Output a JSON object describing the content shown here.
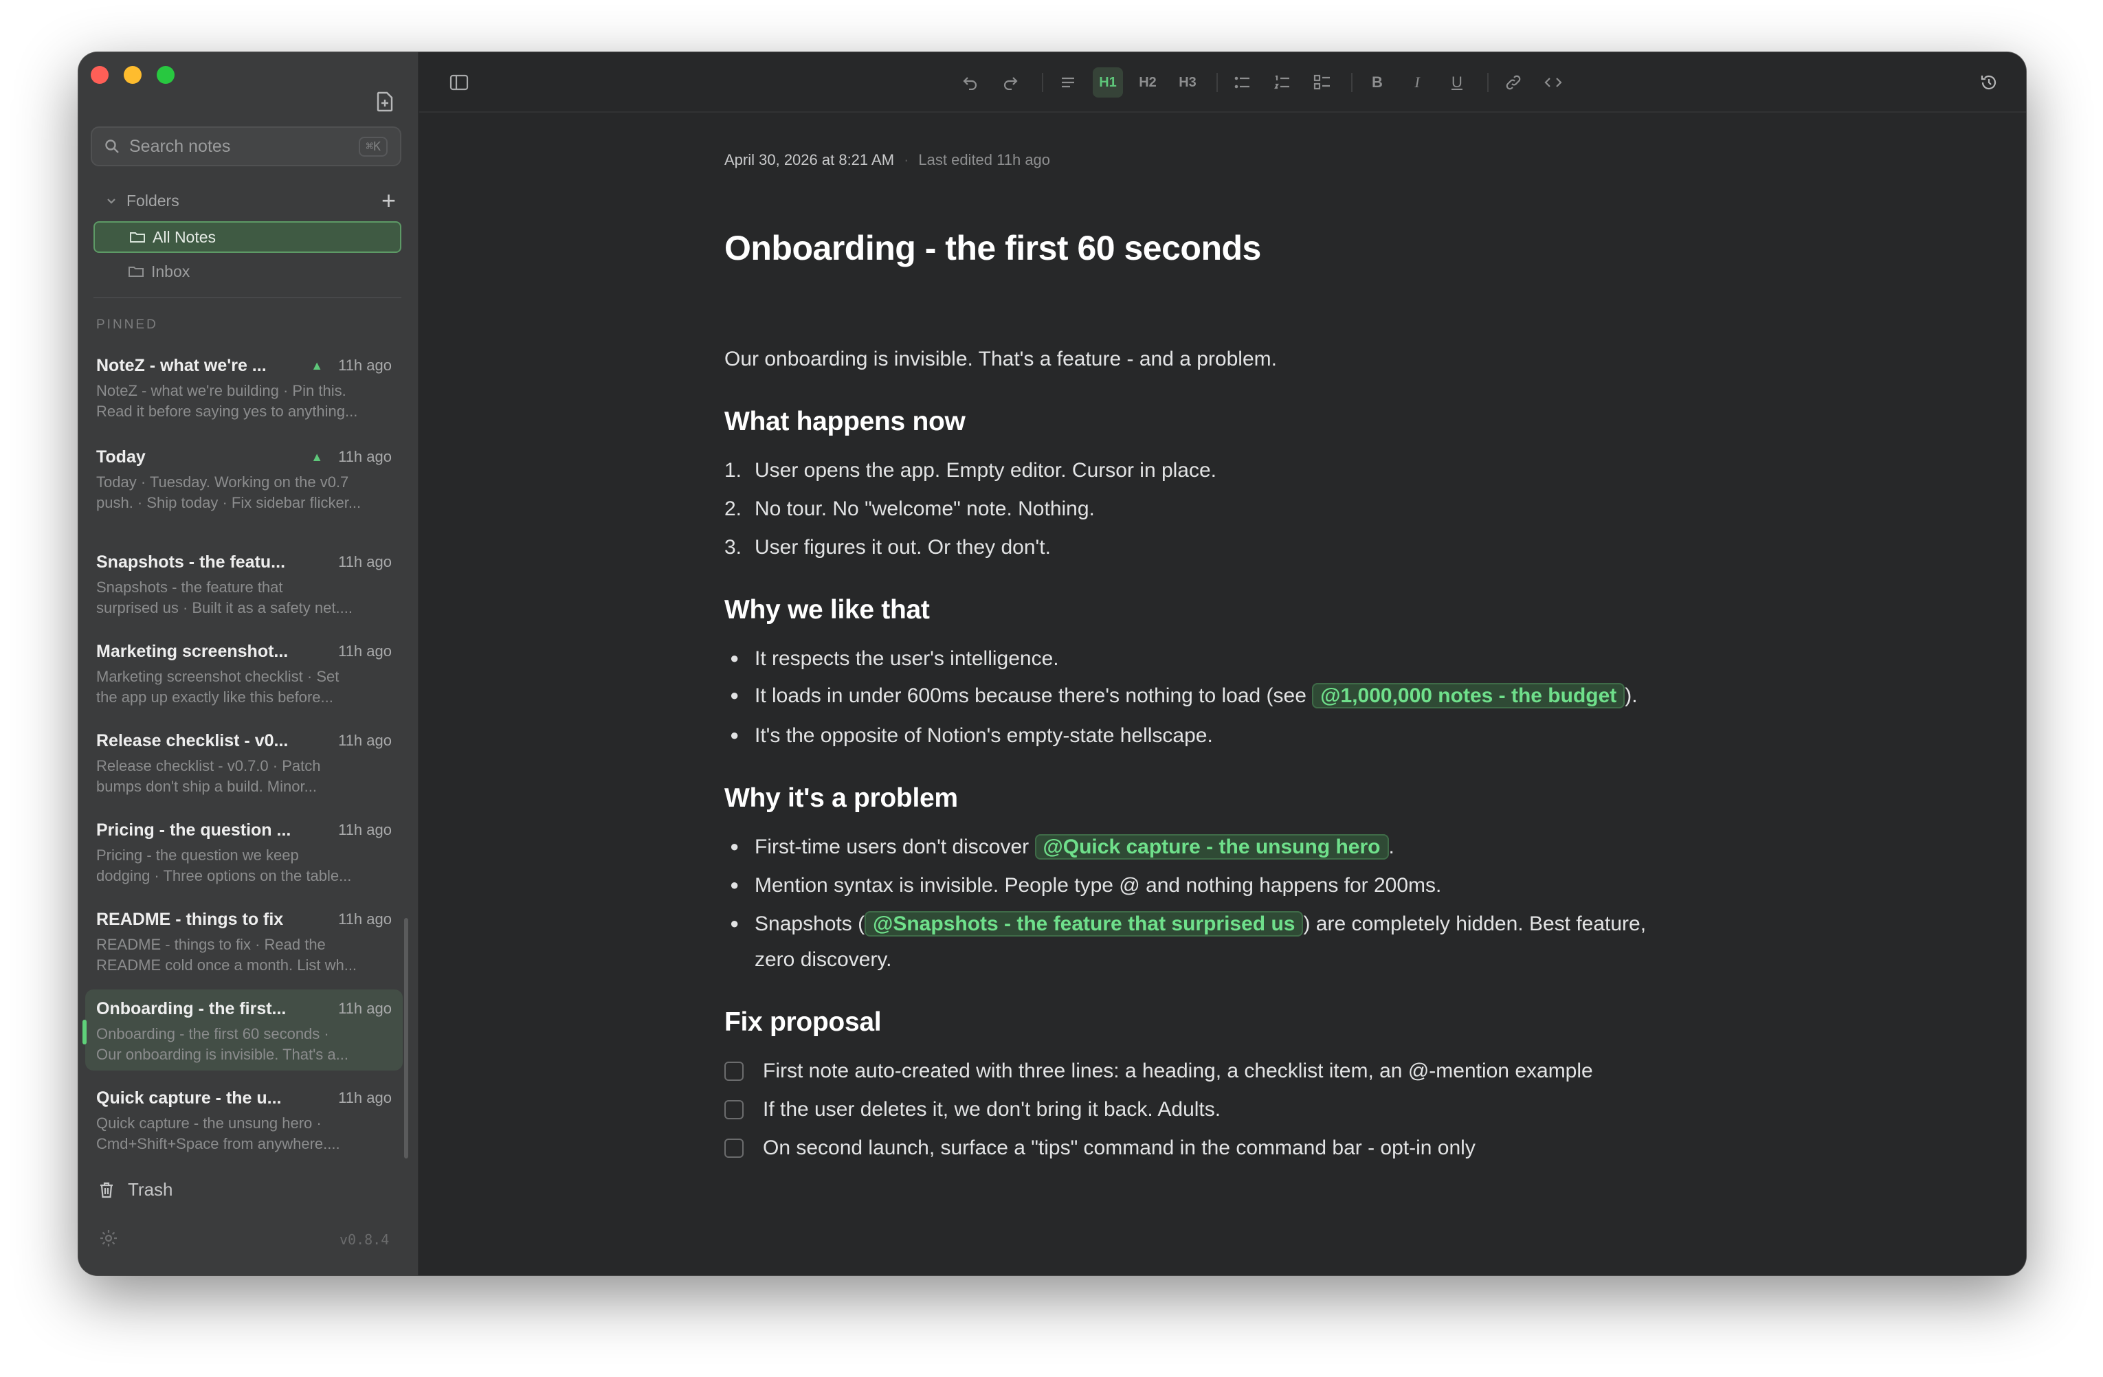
{
  "sidebar": {
    "search_placeholder": "Search notes",
    "search_shortcut": "⌘K",
    "folders_label": "Folders",
    "folders": [
      {
        "label": "All Notes",
        "active": true
      },
      {
        "label": "Inbox",
        "active": false
      }
    ],
    "pinned_label": "PINNED",
    "notes": [
      {
        "title": "NoteZ - what we're ...",
        "time": "11h ago",
        "pinned": true,
        "snippet_1": "NoteZ - what we're building · Pin this.",
        "snippet_2": "Read it before saying yes to anything..."
      },
      {
        "title": "Today",
        "time": "11h ago",
        "pinned": true,
        "snippet_1": "Today · Tuesday. Working on the v0.7",
        "snippet_2": "push. · Ship today · Fix sidebar flicker..."
      },
      {
        "title": "Snapshots - the featu...",
        "time": "11h ago",
        "pinned": false,
        "snippet_1": "Snapshots - the feature that",
        "snippet_2": "surprised us · Built it as a safety net...."
      },
      {
        "title": "Marketing screenshot...",
        "time": "11h ago",
        "pinned": false,
        "snippet_1": "Marketing screenshot checklist · Set",
        "snippet_2": "the app up exactly like this before..."
      },
      {
        "title": "Release checklist - v0...",
        "time": "11h ago",
        "pinned": false,
        "snippet_1": "Release checklist - v0.7.0 · Patch",
        "snippet_2": "bumps don't ship a build. Minor..."
      },
      {
        "title": "Pricing - the question ...",
        "time": "11h ago",
        "pinned": false,
        "snippet_1": "Pricing - the question we keep",
        "snippet_2": "dodging · Three options on the table..."
      },
      {
        "title": "README - things to fix",
        "time": "11h ago",
        "pinned": false,
        "snippet_1": "README - things to fix · Read the",
        "snippet_2": "README cold once a month. List wh..."
      },
      {
        "title": "Onboarding - the first...",
        "time": "11h ago",
        "pinned": false,
        "active": true,
        "snippet_1": "Onboarding - the first 60 seconds ·",
        "snippet_2": "Our onboarding is invisible. That's a..."
      },
      {
        "title": "Quick capture - the u...",
        "time": "11h ago",
        "pinned": false,
        "snippet_1": "Quick capture - the unsung hero ·",
        "snippet_2": "Cmd+Shift+Space from anywhere...."
      }
    ],
    "trash_label": "Trash",
    "version": "v0.8.4"
  },
  "toolbar": {
    "h1_label": "H1",
    "h2_label": "H2",
    "h3_label": "H3",
    "bold": "B",
    "italic": "I",
    "underline": "U"
  },
  "editor": {
    "date": "April 30, 2026 at 8:21 AM",
    "separator": "·",
    "last_edited": "Last edited 11h ago",
    "title": "Onboarding - the first 60 seconds",
    "intro": "Our onboarding is invisible. That's a feature - and a problem.",
    "section1_heading": "What happens now",
    "section1_items": [
      {
        "num": "1.",
        "text": "User opens the app. Empty editor. Cursor in place."
      },
      {
        "num": "2.",
        "text": "No tour. No \"welcome\" note. Nothing."
      },
      {
        "num": "3.",
        "text": "User figures it out. Or they don't."
      }
    ],
    "section2_heading": "Why we like that",
    "s2_item1": "It respects the user's intelligence.",
    "s2_item2_pre": "It loads in under 600ms because there's nothing to load (see ",
    "s2_item2_mention": "@1,000,000 notes - the budget",
    "s2_item2_post": ").",
    "s2_item3": "It's the opposite of Notion's empty-state hellscape.",
    "section3_heading": "Why it's a problem",
    "s3_item1_pre": "First-time users don't discover ",
    "s3_item1_mention": "@Quick capture - the unsung hero",
    "s3_item1_post": ".",
    "s3_item2": "Mention syntax is invisible. People type @ and nothing happens for 200ms.",
    "s3_item3_pre": "Snapshots (",
    "s3_item3_mention": "@Snapshots - the feature that surprised us",
    "s3_item3_post": ") are completely hidden. Best feature,",
    "s3_item3_cont": "zero discovery.",
    "section4_heading": "Fix proposal",
    "checklist": [
      {
        "text": "First note auto-created with three lines: a heading, a checklist item, an @-mention example",
        "checked": false
      },
      {
        "text": "If the user deletes it, we don't bring it back. Adults.",
        "checked": false
      },
      {
        "text": "On second launch, surface a \"tips\" command in the command bar - opt-in only",
        "checked": false
      }
    ]
  },
  "colors": {
    "accent": "#5ec77a",
    "mention_bg": "#2f4a35",
    "sidebar_bg": "#3b3c3d",
    "editor_bg": "#272829"
  }
}
